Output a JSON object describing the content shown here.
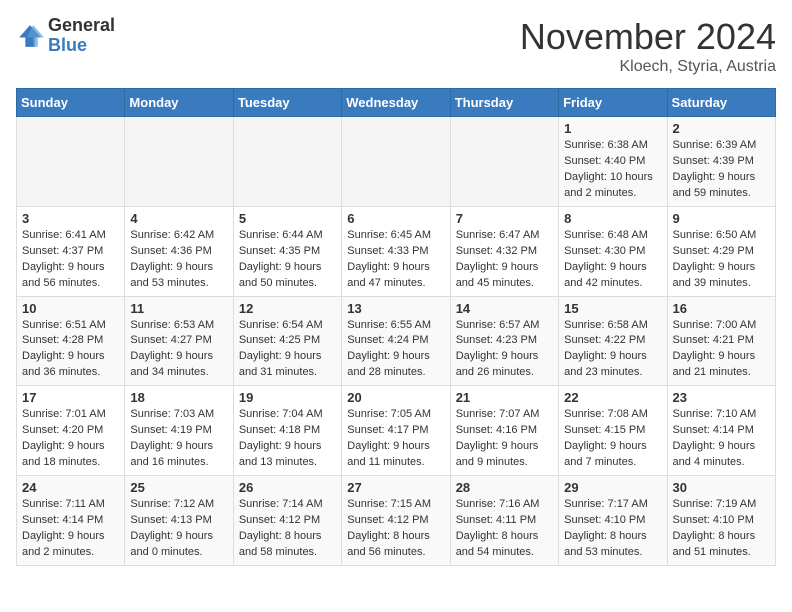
{
  "header": {
    "logo_general": "General",
    "logo_blue": "Blue",
    "month_title": "November 2024",
    "location": "Kloech, Styria, Austria"
  },
  "days_of_week": [
    "Sunday",
    "Monday",
    "Tuesday",
    "Wednesday",
    "Thursday",
    "Friday",
    "Saturday"
  ],
  "weeks": [
    [
      {
        "day": "",
        "info": ""
      },
      {
        "day": "",
        "info": ""
      },
      {
        "day": "",
        "info": ""
      },
      {
        "day": "",
        "info": ""
      },
      {
        "day": "",
        "info": ""
      },
      {
        "day": "1",
        "info": "Sunrise: 6:38 AM\nSunset: 4:40 PM\nDaylight: 10 hours and 2 minutes."
      },
      {
        "day": "2",
        "info": "Sunrise: 6:39 AM\nSunset: 4:39 PM\nDaylight: 9 hours and 59 minutes."
      }
    ],
    [
      {
        "day": "3",
        "info": "Sunrise: 6:41 AM\nSunset: 4:37 PM\nDaylight: 9 hours and 56 minutes."
      },
      {
        "day": "4",
        "info": "Sunrise: 6:42 AM\nSunset: 4:36 PM\nDaylight: 9 hours and 53 minutes."
      },
      {
        "day": "5",
        "info": "Sunrise: 6:44 AM\nSunset: 4:35 PM\nDaylight: 9 hours and 50 minutes."
      },
      {
        "day": "6",
        "info": "Sunrise: 6:45 AM\nSunset: 4:33 PM\nDaylight: 9 hours and 47 minutes."
      },
      {
        "day": "7",
        "info": "Sunrise: 6:47 AM\nSunset: 4:32 PM\nDaylight: 9 hours and 45 minutes."
      },
      {
        "day": "8",
        "info": "Sunrise: 6:48 AM\nSunset: 4:30 PM\nDaylight: 9 hours and 42 minutes."
      },
      {
        "day": "9",
        "info": "Sunrise: 6:50 AM\nSunset: 4:29 PM\nDaylight: 9 hours and 39 minutes."
      }
    ],
    [
      {
        "day": "10",
        "info": "Sunrise: 6:51 AM\nSunset: 4:28 PM\nDaylight: 9 hours and 36 minutes."
      },
      {
        "day": "11",
        "info": "Sunrise: 6:53 AM\nSunset: 4:27 PM\nDaylight: 9 hours and 34 minutes."
      },
      {
        "day": "12",
        "info": "Sunrise: 6:54 AM\nSunset: 4:25 PM\nDaylight: 9 hours and 31 minutes."
      },
      {
        "day": "13",
        "info": "Sunrise: 6:55 AM\nSunset: 4:24 PM\nDaylight: 9 hours and 28 minutes."
      },
      {
        "day": "14",
        "info": "Sunrise: 6:57 AM\nSunset: 4:23 PM\nDaylight: 9 hours and 26 minutes."
      },
      {
        "day": "15",
        "info": "Sunrise: 6:58 AM\nSunset: 4:22 PM\nDaylight: 9 hours and 23 minutes."
      },
      {
        "day": "16",
        "info": "Sunrise: 7:00 AM\nSunset: 4:21 PM\nDaylight: 9 hours and 21 minutes."
      }
    ],
    [
      {
        "day": "17",
        "info": "Sunrise: 7:01 AM\nSunset: 4:20 PM\nDaylight: 9 hours and 18 minutes."
      },
      {
        "day": "18",
        "info": "Sunrise: 7:03 AM\nSunset: 4:19 PM\nDaylight: 9 hours and 16 minutes."
      },
      {
        "day": "19",
        "info": "Sunrise: 7:04 AM\nSunset: 4:18 PM\nDaylight: 9 hours and 13 minutes."
      },
      {
        "day": "20",
        "info": "Sunrise: 7:05 AM\nSunset: 4:17 PM\nDaylight: 9 hours and 11 minutes."
      },
      {
        "day": "21",
        "info": "Sunrise: 7:07 AM\nSunset: 4:16 PM\nDaylight: 9 hours and 9 minutes."
      },
      {
        "day": "22",
        "info": "Sunrise: 7:08 AM\nSunset: 4:15 PM\nDaylight: 9 hours and 7 minutes."
      },
      {
        "day": "23",
        "info": "Sunrise: 7:10 AM\nSunset: 4:14 PM\nDaylight: 9 hours and 4 minutes."
      }
    ],
    [
      {
        "day": "24",
        "info": "Sunrise: 7:11 AM\nSunset: 4:14 PM\nDaylight: 9 hours and 2 minutes."
      },
      {
        "day": "25",
        "info": "Sunrise: 7:12 AM\nSunset: 4:13 PM\nDaylight: 9 hours and 0 minutes."
      },
      {
        "day": "26",
        "info": "Sunrise: 7:14 AM\nSunset: 4:12 PM\nDaylight: 8 hours and 58 minutes."
      },
      {
        "day": "27",
        "info": "Sunrise: 7:15 AM\nSunset: 4:12 PM\nDaylight: 8 hours and 56 minutes."
      },
      {
        "day": "28",
        "info": "Sunrise: 7:16 AM\nSunset: 4:11 PM\nDaylight: 8 hours and 54 minutes."
      },
      {
        "day": "29",
        "info": "Sunrise: 7:17 AM\nSunset: 4:10 PM\nDaylight: 8 hours and 53 minutes."
      },
      {
        "day": "30",
        "info": "Sunrise: 7:19 AM\nSunset: 4:10 PM\nDaylight: 8 hours and 51 minutes."
      }
    ]
  ]
}
